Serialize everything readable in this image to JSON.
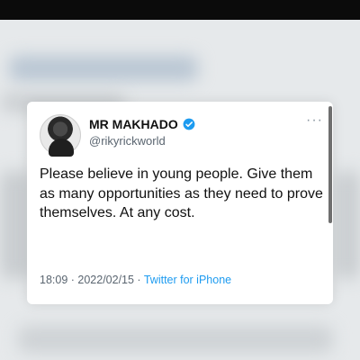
{
  "tweet": {
    "display_name": "MR MAKHADO",
    "handle": "@rikyrickworld",
    "verified": true,
    "text": "Please believe in young people. Give them as many opportunities as they need to prove themselves. At any cost.",
    "time": "18:09",
    "separator1": " · ",
    "date": "2022/02/15",
    "separator2": " · ",
    "source": "Twitter for iPhone"
  },
  "icons": {
    "verified": "verified-badge-icon",
    "more": "more-options-icon",
    "avatar": "profile-avatar"
  },
  "colors": {
    "accent": "#1d9bf0",
    "text_primary": "#111111",
    "text_secondary": "#5a6570",
    "card_background": "#ffffff",
    "top_bar": "#0b0b0b"
  }
}
